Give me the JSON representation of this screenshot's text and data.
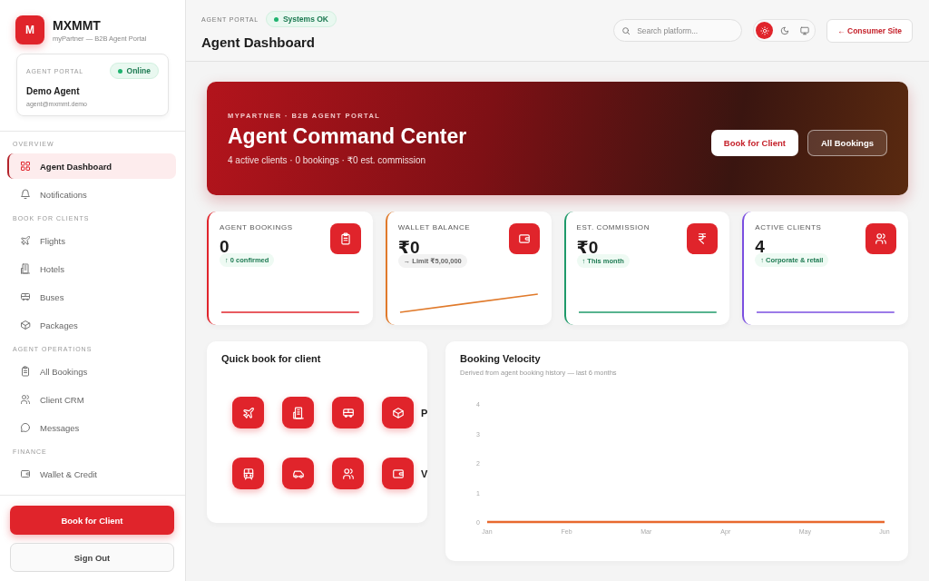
{
  "sidebar": {
    "brand": {
      "logo_letter": "M",
      "name": "MXMMT",
      "tagline": "myPartner — B2B Agent Portal"
    },
    "agent_card": {
      "label": "AGENT PORTAL",
      "status": "Online",
      "name": "Demo Agent",
      "email": "agent@mxmmt.demo"
    },
    "sections": [
      {
        "title": "OVERVIEW",
        "items": [
          {
            "label": "Agent Dashboard",
            "selected": true
          },
          {
            "label": "Notifications",
            "selected": false
          }
        ]
      },
      {
        "title": "BOOK FOR CLIENTS",
        "items": [
          {
            "label": "Flights",
            "selected": false
          },
          {
            "label": "Hotels",
            "selected": false
          },
          {
            "label": "Buses",
            "selected": false
          },
          {
            "label": "Packages",
            "selected": false
          }
        ]
      },
      {
        "title": "AGENT OPERATIONS",
        "items": [
          {
            "label": "All Bookings",
            "selected": false
          },
          {
            "label": "Client CRM",
            "selected": false
          },
          {
            "label": "Messages",
            "selected": false
          }
        ]
      },
      {
        "title": "FINANCE",
        "items": [
          {
            "label": "Wallet & Credit",
            "selected": false
          }
        ]
      }
    ],
    "primary_button": "Book for Client",
    "secondary_button": "Sign Out"
  },
  "header": {
    "eyebrow": "AGENT PORTAL",
    "status": "Systems OK",
    "title": "Agent Dashboard",
    "search": {
      "placeholder": "Search platform..."
    },
    "theme_toggles": [
      {
        "selected": true
      },
      {
        "selected": false
      },
      {
        "selected": false
      }
    ],
    "consumer_link": "← Consumer Site"
  },
  "hero": {
    "eyebrow": "MYPARTNER · B2B AGENT PORTAL",
    "title": "Agent Command Center",
    "subtitle": "4 active clients · 0 bookings · ₹0 est. commission",
    "buttons": [
      {
        "label": "Book for Client",
        "kind": "solid"
      },
      {
        "label": "All Bookings",
        "kind": "outline"
      }
    ]
  },
  "stats": [
    {
      "label": "AGENT BOOKINGS",
      "value": "0",
      "badge": {
        "text": "↑ 0 confirmed",
        "kind": "up"
      },
      "color": "#e0242b",
      "sparkline": {
        "kind": "flat"
      }
    },
    {
      "label": "WALLET BALANCE",
      "value": "₹0",
      "badge": {
        "text": "→ Limit ₹5,00,000",
        "kind": "neutral"
      },
      "color": "#e07a2b",
      "sparkline": {
        "kind": "rising"
      }
    },
    {
      "label": "EST. COMMISSION",
      "value": "₹0",
      "badge": {
        "text": "↑ This month",
        "kind": "up"
      },
      "color": "#1f9a6a",
      "sparkline": {
        "kind": "flat"
      }
    },
    {
      "label": "ACTIVE CLIENTS",
      "value": "4",
      "badge": {
        "text": "↑ Corporate & retail",
        "kind": "up"
      },
      "color": "#7b4fe0",
      "sparkline": {
        "kind": "flat"
      }
    }
  ],
  "quick_book": {
    "title": "Quick book for client",
    "row_labels": [
      "P",
      "V"
    ]
  },
  "velocity": {
    "title": "Booking Velocity",
    "subtitle": "Derived from agent booking history — last 6 months",
    "chart_data": {
      "type": "line",
      "categories": [
        "Jan",
        "Feb",
        "Mar",
        "Apr",
        "May",
        "Jun"
      ],
      "series": [
        {
          "color": "#e8692e",
          "values": [
            0,
            0,
            0,
            0,
            0,
            0
          ]
        }
      ],
      "ylim": [
        0,
        4
      ],
      "yticks": [
        {
          "value": 0,
          "label": "0"
        },
        {
          "value": 1,
          "label": "1"
        },
        {
          "value": 2,
          "label": "2"
        },
        {
          "value": 3,
          "label": "3"
        },
        {
          "value": 4,
          "label": "4"
        }
      ]
    }
  }
}
